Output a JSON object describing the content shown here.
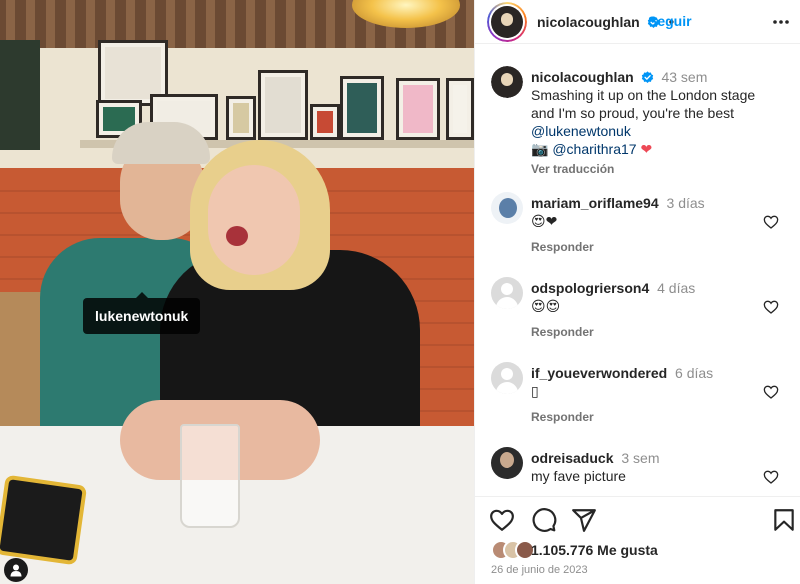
{
  "photo": {
    "tag_label": "lukenewtonuk",
    "alt": ""
  },
  "header": {
    "username": "nicolacoughlan",
    "follow_label": "Seguir"
  },
  "caption": {
    "username": "nicolacoughlan",
    "time": "43 sem",
    "text": "Smashing it up on the London stage and I'm so proud, you're the best",
    "mention": "@lukenewtonuk",
    "camera_emoji": "📷",
    "credit": "@charithra17",
    "heart": "❤",
    "see_translation": "Ver traducción"
  },
  "comments": [
    {
      "username": "mariam_oriflame94",
      "time": "3 días",
      "text": "😍❤",
      "reply_label": "Responder"
    },
    {
      "username": "odspologrierson4",
      "time": "4 días",
      "text": "😍😍",
      "reply_label": "Responder"
    },
    {
      "username": "if_youeverwondered",
      "time": "6 días",
      "text": "▯",
      "reply_label": "Responder"
    },
    {
      "username": "odreisaduck",
      "time": "3 sem",
      "text": "my fave picture",
      "reply_label": ""
    }
  ],
  "likes": {
    "count_text": "1.105.776 Me gusta"
  },
  "post_date": "26 de junio de 2023",
  "colors": {
    "follow_blue": "#0095f6",
    "verified_blue": "#0095f6",
    "like_red": "#ed4956",
    "secondary_text": "#737373"
  },
  "icons": [
    "verified-badge-icon",
    "more-options-icon",
    "heart-icon",
    "comment-icon",
    "share-icon",
    "bookmark-icon",
    "user-tag-icon"
  ]
}
